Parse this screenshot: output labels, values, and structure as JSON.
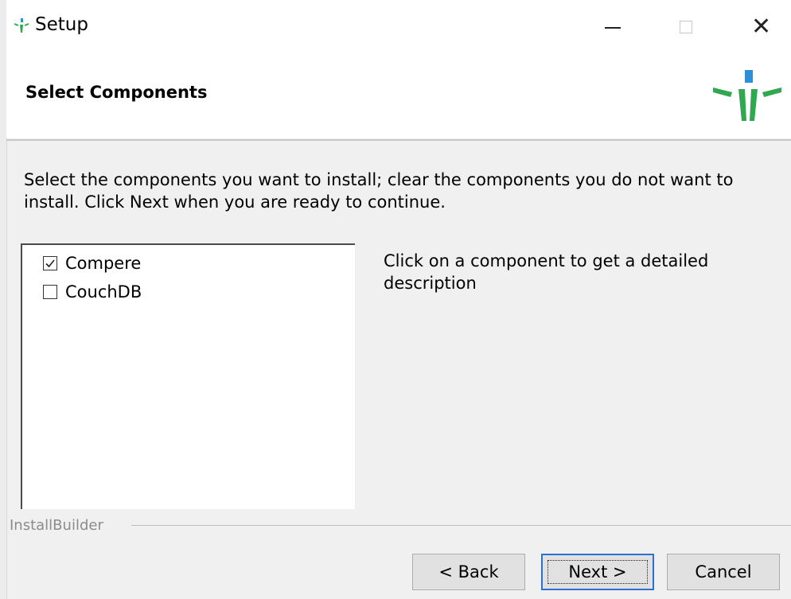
{
  "window": {
    "title": "Setup",
    "controls": [
      "minimize",
      "maximize",
      "close"
    ],
    "close_glyph": "✕"
  },
  "header": {
    "title": "Select Components",
    "logo_icon": "installer-logo-icon"
  },
  "instructions": "Select the components you want to install; clear the components you do not want to install. Click Next when you are ready to continue.",
  "components": [
    {
      "label": "Compere",
      "checked": true
    },
    {
      "label": "CouchDB",
      "checked": false
    }
  ],
  "description": "Click on a component to get a detailed description",
  "footer": {
    "brand": "InstallBuilder"
  },
  "buttons": {
    "back": "< Back",
    "next": "Next >",
    "cancel": "Cancel"
  },
  "colors": {
    "accent_blue": "#2f6fd1",
    "logo_green": "#2fa84f",
    "logo_blue": "#2d8fd6"
  }
}
